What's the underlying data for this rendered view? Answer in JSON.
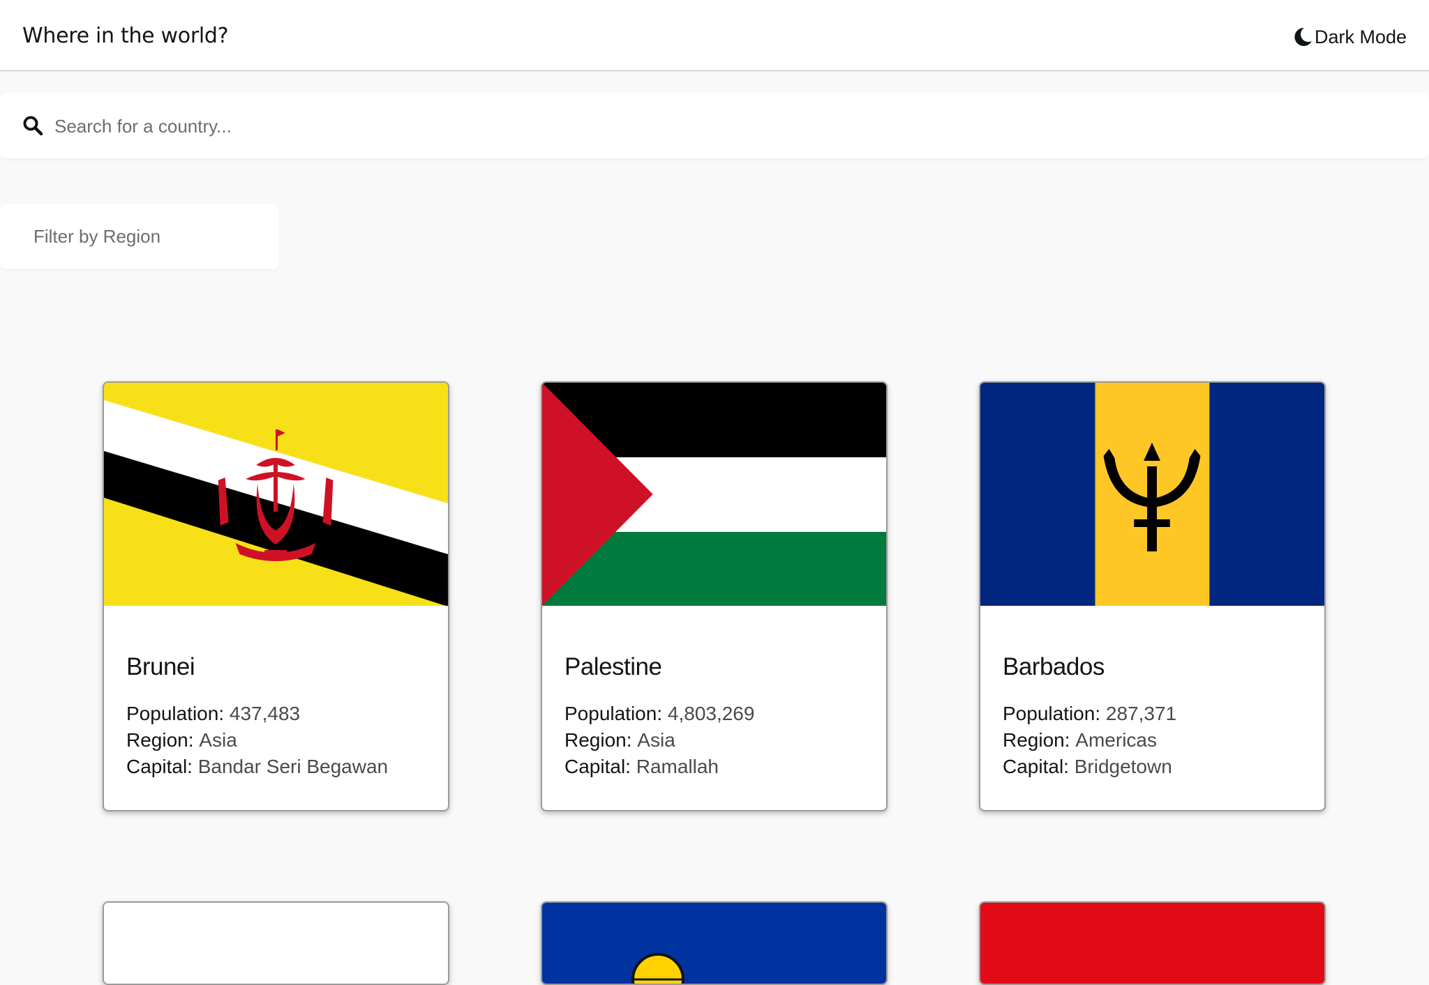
{
  "header": {
    "title": "Where in the world?",
    "theme_toggle_label": "Dark Mode"
  },
  "search": {
    "placeholder": "Search for a country...",
    "value": ""
  },
  "filter": {
    "label": "Filter by Region"
  },
  "labels": {
    "population": "Population:",
    "region": "Region:",
    "capital": "Capital:"
  },
  "countries": [
    {
      "name": "Brunei",
      "population": "437,483",
      "region": "Asia",
      "capital": "Bandar Seri Begawan",
      "flag_icon": "brunei-flag"
    },
    {
      "name": "Palestine",
      "population": "4,803,269",
      "region": "Asia",
      "capital": "Ramallah",
      "flag_icon": "palestine-flag"
    },
    {
      "name": "Barbados",
      "population": "287,371",
      "region": "Americas",
      "capital": "Bridgetown",
      "flag_icon": "barbados-flag"
    }
  ],
  "partial_cards": [
    {
      "flag_color": "#ffffff"
    },
    {
      "flag_color": "#0033a0"
    },
    {
      "flag_color": "#e30a17"
    }
  ],
  "colors": {
    "background": "#f9f9f9",
    "surface": "#ffffff",
    "text": "#111517",
    "muted": "#6d6d6d"
  }
}
